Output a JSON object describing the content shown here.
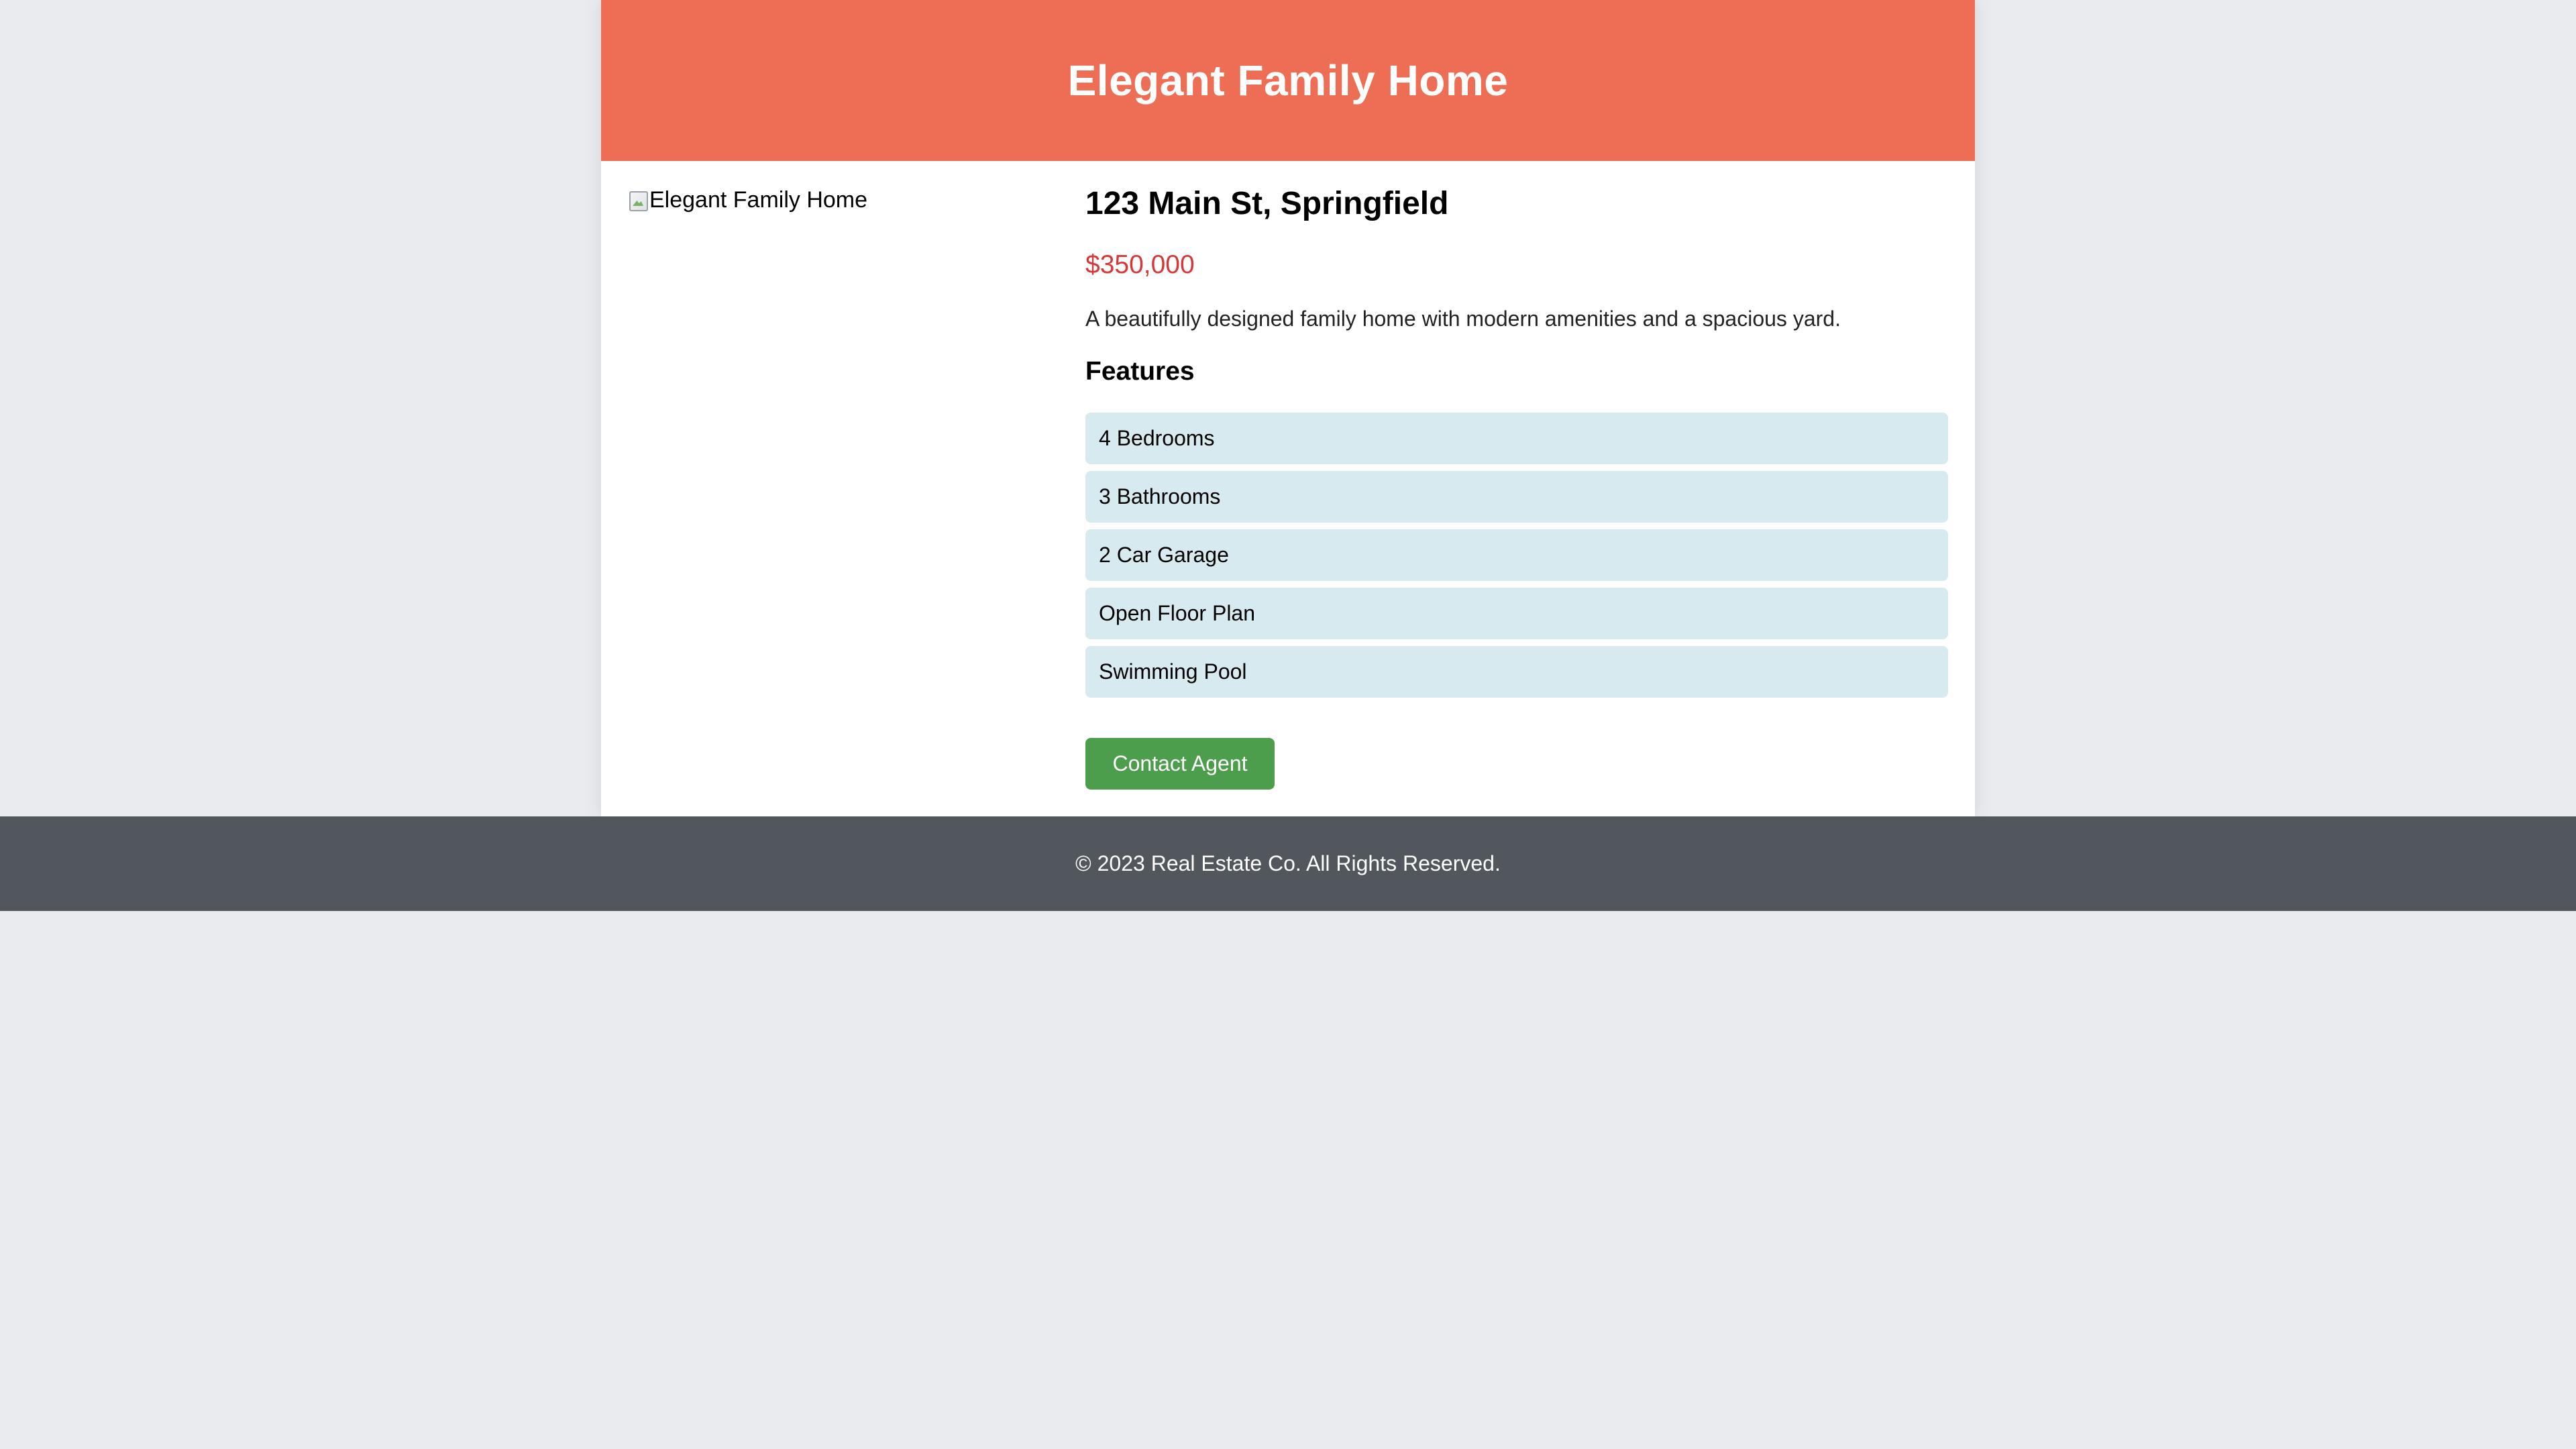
{
  "header": {
    "title": "Elegant Family Home"
  },
  "listing": {
    "image_alt": "Elegant Family Home",
    "address": "123 Main St, Springfield",
    "price": "$350,000",
    "description": "A beautifully designed family home with modern amenities and a spacious yard.",
    "features_heading": "Features",
    "features": [
      "4 Bedrooms",
      "3 Bathrooms",
      "2 Car Garage",
      "Open Floor Plan",
      "Swimming Pool"
    ],
    "contact_button_label": "Contact Agent"
  },
  "footer": {
    "copyright": "© 2023 Real Estate Co. All Rights Reserved."
  },
  "colors": {
    "header_bg": "#ee6e55",
    "price_text": "#d6383a",
    "feature_bg": "#d7eaef",
    "button_bg": "#4c9e4c",
    "footer_bg": "#52575d",
    "page_bg": "#e9ebee"
  },
  "icons": {
    "image_placeholder": "broken-image-icon"
  }
}
